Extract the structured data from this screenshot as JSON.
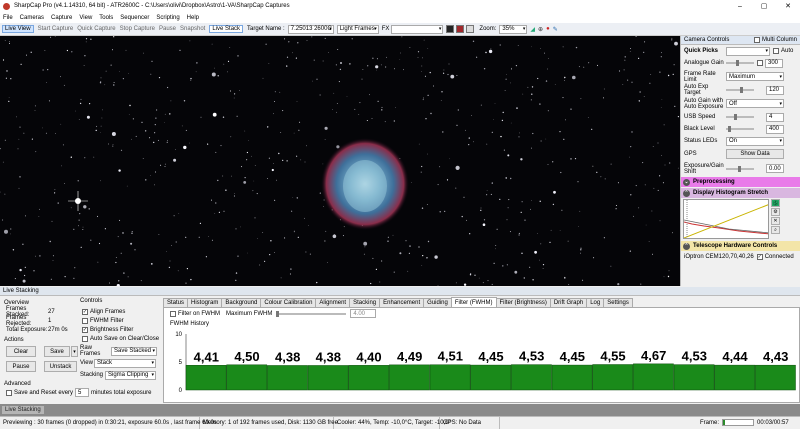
{
  "window": {
    "title": "SharpCap Pro (v4.1.14310, 64 bit) - ATR2600C - C:\\Users\\olivi\\Dropbox\\Astro\\1-VA\\SharpCap Captures"
  },
  "menu": [
    "File",
    "Cameras",
    "Capture",
    "View",
    "Tools",
    "Sequencer",
    "Scripting",
    "Help"
  ],
  "toolbar": {
    "live_view": "Live View",
    "start_capture": "Start Capture",
    "quick_capture": "Quick Capture",
    "stop_capture": "Stop Capture",
    "pause": "Pause",
    "snapshot": "Snapshot",
    "live_stack": "Live Stack",
    "target_name_label": "Target Name :",
    "target_name_value": "7.25013 2600C",
    "frame_type": "Light Frames",
    "fx_label": "FX",
    "zoom_label": "Zoom:",
    "zoom_value": "35%"
  },
  "camera_controls": {
    "title": "Camera Controls",
    "multi_column": "Multi Column",
    "quick_picks_label": "Quick Picks",
    "auto_label": "Auto",
    "rows": [
      {
        "label": "Analogue Gain",
        "value": "300"
      },
      {
        "label": "Frame Rate Limit",
        "value": "Maximum"
      },
      {
        "label": "Auto Exp Target",
        "value": "120"
      },
      {
        "label": "Auto Gain with Auto Exposure",
        "value": "Off"
      },
      {
        "label": "USB Speed",
        "value": "4"
      },
      {
        "label": "Black Level",
        "value": "400"
      },
      {
        "label": "Status LEDs",
        "value": "On"
      },
      {
        "label": "GPS",
        "value": "Show Data"
      },
      {
        "label": "Exposure/Gain Shift",
        "value": "0.00"
      }
    ],
    "preprocessing": "Preprocessing",
    "histogram": "Display Histogram Stretch",
    "telescope": "Telescope Hardware Controls",
    "mount": "iOptron CEM120,70,40,26",
    "connected": "Connected",
    "colors": {
      "preprocessing": "#e97be9",
      "histogram": "#d9b7e0",
      "telescope": "#f3e5a8"
    }
  },
  "live_stacking": {
    "label": "Live Stacking",
    "overview": {
      "title": "Overview",
      "frames_stacked_label": "Frames Stacked:",
      "frames_stacked": "27",
      "frames_rejected_label": "Frames Rejected:",
      "frames_rejected": "1",
      "total_exposure_label": "Total Exposure:",
      "total_exposure": "27m 0s"
    },
    "actions": {
      "title": "Actions",
      "clear": "Clear",
      "save": "Save",
      "pause": "Pause",
      "unstack": "Unstack"
    },
    "advanced": {
      "title": "Advanced",
      "save_reset": "Save and Reset every",
      "minutes_value": "5",
      "minutes_label": "minutes total exposure"
    },
    "controls": {
      "title": "Controls",
      "align": "Align Frames",
      "fwhm": "FWHM Filter",
      "brightness": "Brightness Filter",
      "autosave": "Auto Save on Clear/Close",
      "raw_frames_label": "Raw Frames",
      "raw_frames_value": "Save Stacked",
      "view_label": "View",
      "view_value": "Stack",
      "stacking_label": "Stacking",
      "stacking_value": "Sigma Clipping"
    },
    "tabs": [
      "Status",
      "Histogram",
      "Background",
      "Colour Calibration",
      "Alignment",
      "Stacking",
      "Enhancement",
      "Guiding",
      "Filter (FWHM)",
      "Filter (Brightness)",
      "Drift Graph",
      "Log",
      "Settings"
    ],
    "selected_tab": "Filter (FWHM)",
    "fwhm": {
      "filter_label": "Filter on FWHM",
      "max_label": "Maximum FWHM",
      "max_value": "4.00",
      "history_label": "FWHM History"
    }
  },
  "chart_data": {
    "type": "bar",
    "title": "FWHM History",
    "xlabel": "",
    "ylabel": "",
    "ylim": [
      0,
      10
    ],
    "ticks": [
      "10",
      "5",
      "0"
    ],
    "bar_color": "#1a8a1a",
    "values": [
      4.41,
      4.5,
      4.38,
      4.38,
      4.4,
      4.49,
      4.51,
      4.45,
      4.53,
      4.45,
      4.55,
      4.67,
      4.53,
      4.44,
      4.43
    ],
    "labels": [
      "4,41",
      "4,50",
      "4,38",
      "4,38",
      "4,40",
      "4,49",
      "4,51",
      "4,45",
      "4,53",
      "4,45",
      "4,55",
      "4,67",
      "4,53",
      "4,44",
      "4,43"
    ]
  },
  "bottom_tab": "Live Stacking",
  "status": {
    "preview": "Previewing : 30 frames (0 dropped) in 0:30:21, exposure 60.0s , last frame 60.0s",
    "memory": "Memory: 1 of 192 frames used, Disk: 1130 GB free",
    "cooler": "Cooler: 44%, Temp: -10,0°C, Target: -10,0°",
    "gps": "GPS: No Data",
    "frame_label": "Frame:",
    "time": "00:03/00:57"
  }
}
